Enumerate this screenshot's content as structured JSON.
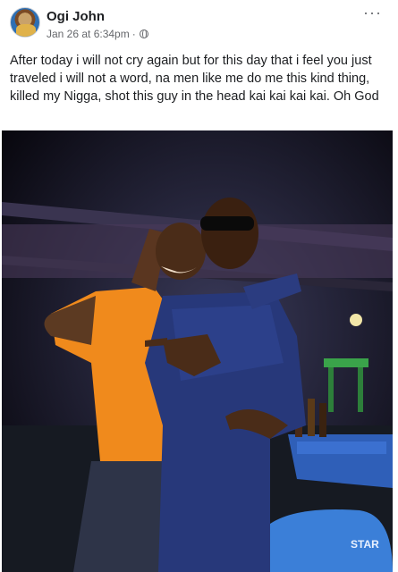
{
  "post": {
    "author": "Ogi John",
    "timestamp": "Jan 26 at 6:34pm",
    "separator": "·",
    "privacy_icon": "globe-icon",
    "more_icon": "ellipsis-icon",
    "more_label": "···",
    "text": "After today i will not cry again but for this day that i feel you just traveled i will not a word, na men like me do me this kind thing, killed my Nigga, shot this guy in the head kai kai kai kai. Oh God"
  },
  "photo": {
    "sign_text": "STAR"
  },
  "colors": {
    "name": "#1c1e21",
    "meta": "#65676b",
    "background": "#ffffff"
  }
}
